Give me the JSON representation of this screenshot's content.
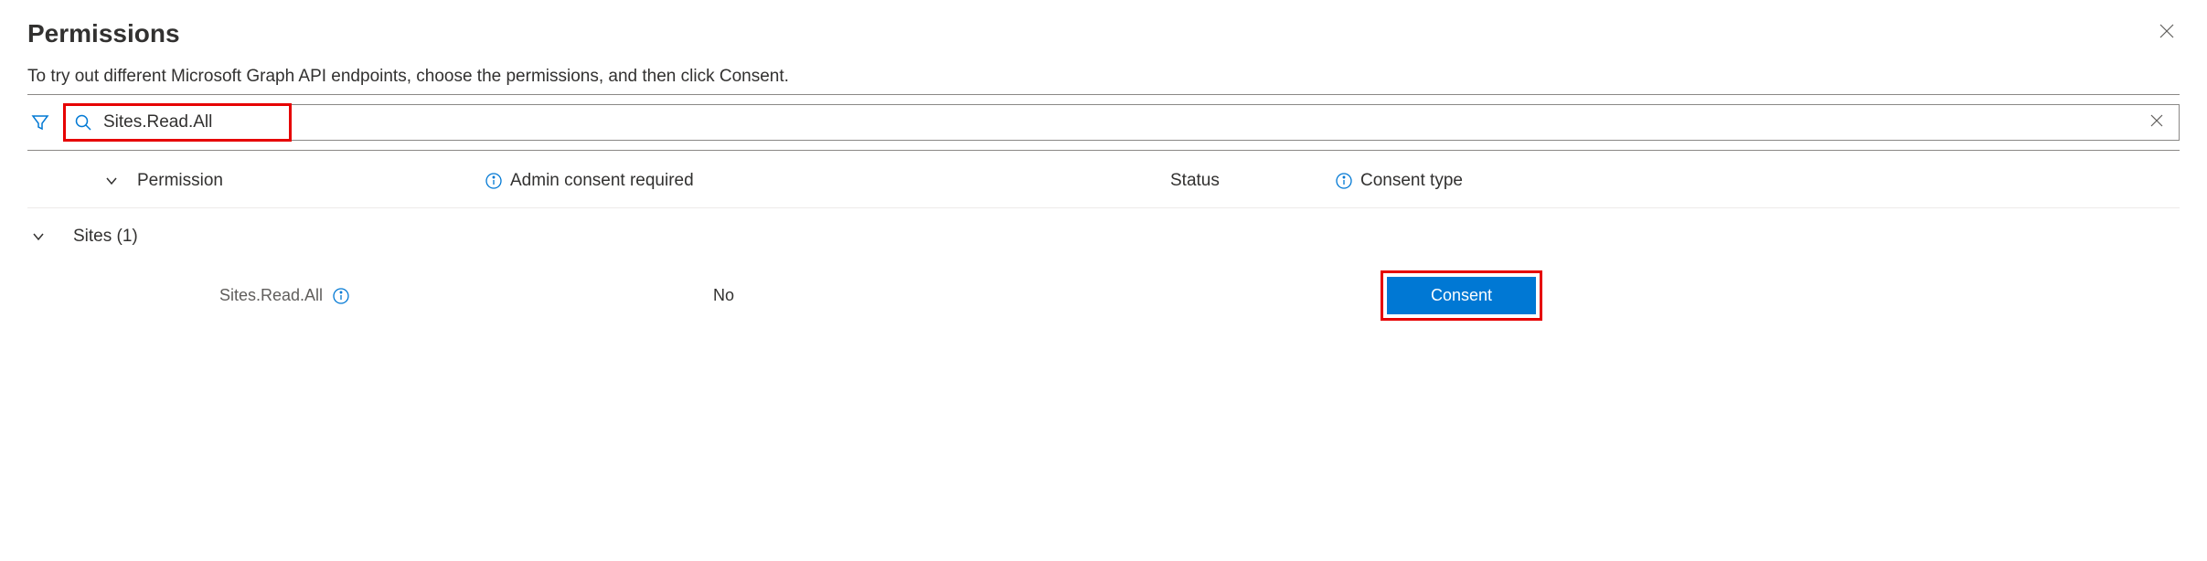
{
  "header": {
    "title": "Permissions"
  },
  "description": "To try out different Microsoft Graph API endpoints, choose the permissions, and then click Consent.",
  "search": {
    "value": "Sites.Read.All"
  },
  "columns": {
    "permission": "Permission",
    "admin_consent": "Admin consent required",
    "status": "Status",
    "consent_type": "Consent type"
  },
  "group": {
    "label": "Sites (1)"
  },
  "rows": [
    {
      "permission": "Sites.Read.All",
      "admin_consent": "No",
      "status": "",
      "consent_button": "Consent"
    }
  ]
}
